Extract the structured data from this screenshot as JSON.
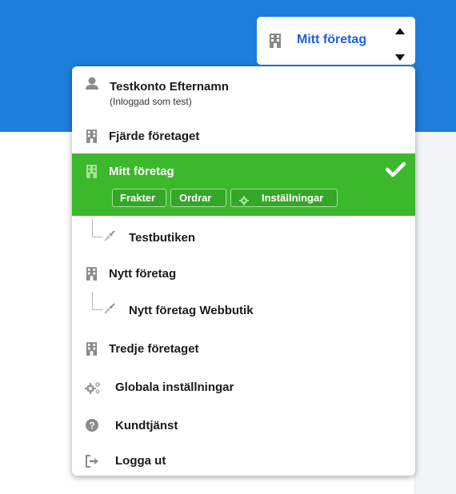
{
  "header": {
    "switcher_label": "Mitt företag",
    "switcher_icon": "building-icon",
    "caret_up_icon": "caret-up-icon",
    "caret_down_icon": "caret-down-icon"
  },
  "colors": {
    "header_bg": "#1f7ddb",
    "accent_link": "#1f5fd6",
    "selected_bg": "#3cb82d"
  },
  "menu": {
    "user": {
      "name": "Testkonto Efternamn",
      "subtitle": "(Inloggad som test)",
      "icon": "user-icon"
    },
    "companies": [
      {
        "label": "Fjärde företaget",
        "icon": "building-icon"
      },
      {
        "label": "Mitt företag",
        "icon": "building-icon",
        "selected": true,
        "chips": [
          {
            "label": "Frakter"
          },
          {
            "label": "Ordrar"
          },
          {
            "label": "Inställningar",
            "icon": "gear-icon"
          }
        ],
        "check_icon": "checkmark-icon"
      },
      {
        "label": "Testbutiken",
        "icon": "compress-arrows-icon",
        "child": true
      },
      {
        "label": "Nytt företag",
        "icon": "building-icon"
      },
      {
        "label": "Nytt företag Webbutik",
        "icon": "compress-arrows-icon",
        "child": true
      },
      {
        "label": "Tredje företaget",
        "icon": "building-icon"
      }
    ],
    "actions": [
      {
        "label": "Globala inställningar",
        "icon": "gears-icon"
      },
      {
        "label": "Kundtjänst",
        "icon": "question-circle-icon"
      },
      {
        "label": "Logga ut",
        "icon": "sign-out-icon"
      }
    ]
  }
}
